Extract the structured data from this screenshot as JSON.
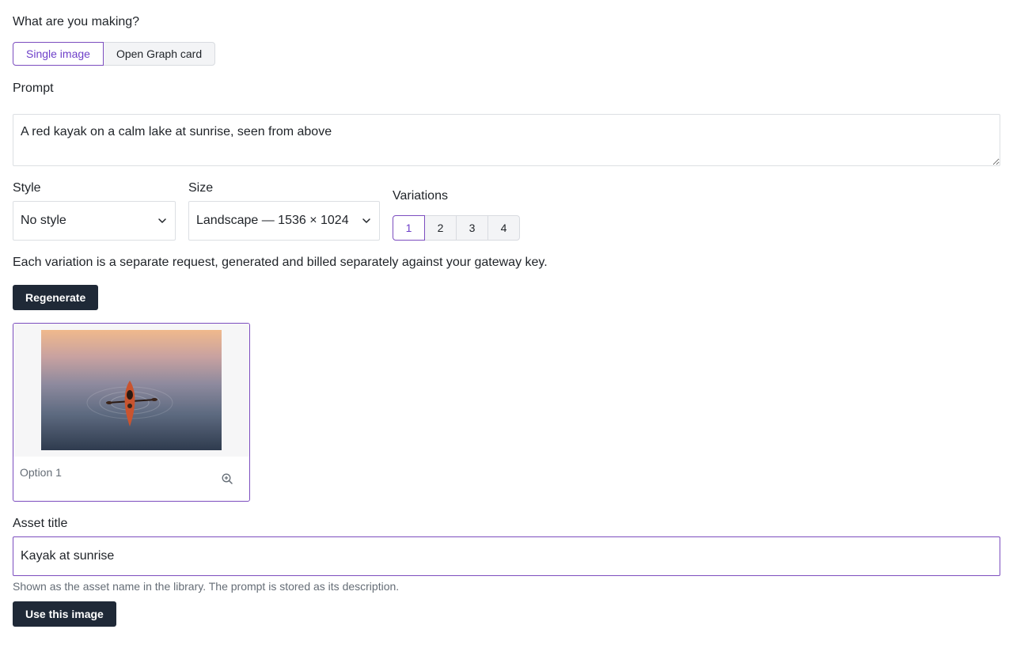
{
  "mode": {
    "question": "What are you making?",
    "options": [
      "Single image",
      "Open Graph card"
    ],
    "selected": "Single image"
  },
  "prompt": {
    "label": "Prompt",
    "value": "A red kayak on a calm lake at sunrise, seen from above"
  },
  "style": {
    "label": "Style",
    "value": "No style"
  },
  "size": {
    "label": "Size",
    "value": "Landscape — 1536 × 1024"
  },
  "variations": {
    "label": "Variations",
    "options": [
      "1",
      "2",
      "3",
      "4"
    ],
    "selected": "1",
    "note": "Each variation is a separate request, generated and billed separately against your gateway key."
  },
  "regenerate_label": "Regenerate",
  "results": [
    {
      "caption": "Option 1",
      "icon": "zoom-in-icon"
    }
  ],
  "asset_title": {
    "label": "Asset title",
    "value": "Kayak at sunrise",
    "help": "Shown as the asset name in the library. The prompt is stored as its description."
  },
  "use_label": "Use this image",
  "colors": {
    "accent": "#7c4dbf",
    "dark_button": "#1f2937"
  }
}
